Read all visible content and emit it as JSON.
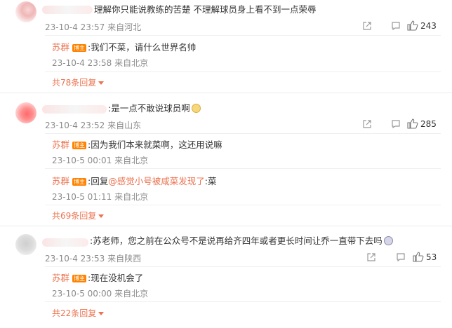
{
  "comments": [
    {
      "text": "理解你只能说教练的苦楚   不理解球员身上看不到一点荣辱",
      "time": "23-10-4 23:57",
      "location": "来自河北",
      "likes": "243",
      "replies": [
        {
          "author": "苏群",
          "badge": "博主",
          "text": ":我们不菜，请什么世界名帅",
          "time": "23-10-4 23:58",
          "location": "来自北京"
        }
      ],
      "more": "共78条回复"
    },
    {
      "text": ":是一点不敢说球员啊",
      "time": "23-10-4 23:52",
      "location": "来自山东",
      "likes": "285",
      "replies": [
        {
          "author": "苏群",
          "badge": "博主",
          "text": ":因为我们本来就菜啊，这还用说嘛",
          "time": "23-10-5 00:01",
          "location": "来自北京"
        },
        {
          "author": "苏群",
          "badge": "博主",
          "prefix": ":回复",
          "mention": "@感觉小号被咸菜发现了",
          "suffix": ":菜",
          "time": "23-10-5 01:11",
          "location": "来自北京"
        }
      ],
      "more": "共69条回复"
    },
    {
      "text": ":苏老师，您之前在公众号不是说再给齐四年或者更长时间让乔一直带下去吗",
      "time": "23-10-4 23:53",
      "location": "来自陕西",
      "likes": "53",
      "replies": [
        {
          "author": "苏群",
          "badge": "博主",
          "text": ":现在没机会了",
          "time": "23-10-5 00:00",
          "location": "来自北京"
        }
      ],
      "more": "共22条回复"
    }
  ],
  "icons": {
    "share": "share-icon",
    "comment": "comment-icon",
    "like": "thumbs-up-icon",
    "cat_emoji": "cat-emoji-icon",
    "cry_emoji": "crying-emoji-icon"
  },
  "colors": {
    "accent": "#eb7350",
    "badge": "#ff8200",
    "meta": "#8c8c8c"
  }
}
